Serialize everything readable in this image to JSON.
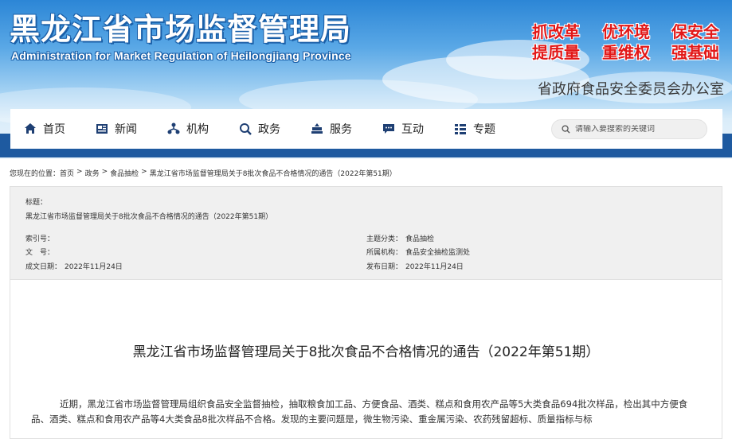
{
  "header": {
    "title_cn": "黑龙江省市场监督管理局",
    "title_en": "Administration for Market Regulation of Heilongjiang Province",
    "slogans": [
      "抓改革",
      "优环境",
      "保安全",
      "提质量",
      "重维权",
      "强基础"
    ],
    "office": "省政府食品安全委员会办公室"
  },
  "nav": {
    "items": [
      {
        "label": "首页",
        "icon": "home-icon"
      },
      {
        "label": "新闻",
        "icon": "news-icon"
      },
      {
        "label": "机构",
        "icon": "organization-icon"
      },
      {
        "label": "政务",
        "icon": "government-icon"
      },
      {
        "label": "服务",
        "icon": "service-icon"
      },
      {
        "label": "互动",
        "icon": "chat-icon"
      },
      {
        "label": "专题",
        "icon": "topic-icon"
      }
    ],
    "search_placeholder": "请输入要搜索的关键词",
    "accent": "#1e5aa0"
  },
  "breadcrumb": {
    "prefix": "您现在的位置：",
    "items": [
      "首页",
      "政务",
      "食品抽检",
      "黑龙江省市场监督管理局关于8批次食品不合格情况的通告（2022年第51期）"
    ],
    "separator": ">"
  },
  "meta": {
    "title_label": "标题：",
    "title_value": "黑龙江省市场监督管理局关于8批次食品不合格情况的通告（2022年第51期）",
    "index_label": "索引号：",
    "index_value": "",
    "doc_label": "文　号：",
    "doc_value": "",
    "created_label": "成文日期：",
    "created_value": "2022年11月24日",
    "topic_label": "主题分类：",
    "topic_value": "食品抽检",
    "org_label": "所属机构：",
    "org_value": "食品安全抽检监测处",
    "published_label": "发布日期：",
    "published_value": "2022年11月24日"
  },
  "article": {
    "title": "黑龙江省市场监督管理局关于8批次食品不合格情况的通告（2022年第51期）",
    "body": "近期，黑龙江省市场监督管理局组织食品安全监督抽检，抽取粮食加工品、方便食品、酒类、糕点和食用农产品等5大类食品694批次样品，检出其中方便食品、酒类、糕点和食用农产品等4大类食品8批次样品不合格。发现的主要问题是，微生物污染、重金属污染、农药残留超标、质量指标与标"
  }
}
